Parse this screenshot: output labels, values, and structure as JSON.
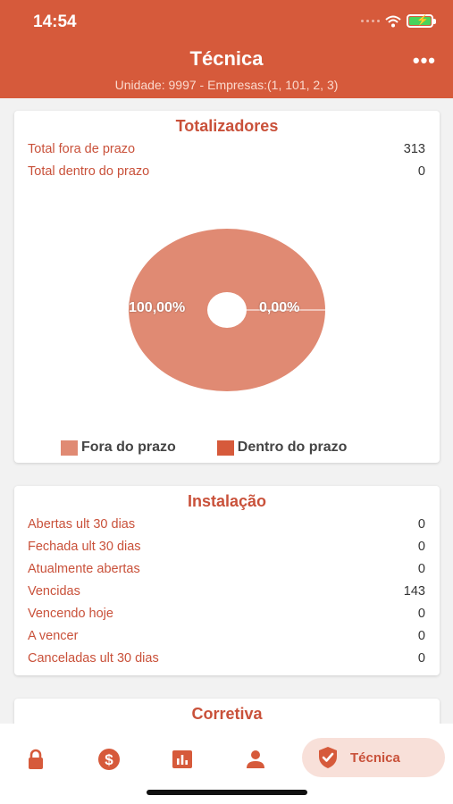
{
  "status_bar": {
    "time": "14:54",
    "battery_color": "#49d35b"
  },
  "header": {
    "title": "Técnica",
    "subtitle": "Unidade: 9997 - Empresas:(1, 101, 2, 3)",
    "more_label": "•••",
    "background": "#d65a3b"
  },
  "totalizadores": {
    "title": "Totalizadores",
    "rows": [
      {
        "label": "Total fora de prazo",
        "value": "313"
      },
      {
        "label": "Total dentro do prazo",
        "value": "0"
      }
    ]
  },
  "chart_data": {
    "type": "pie",
    "categories": [
      "Fora do prazo",
      "Dentro do prazo"
    ],
    "values": [
      313,
      0
    ],
    "percent_labels": [
      "100,00%",
      "0,00%"
    ],
    "colors": [
      "#e08a73",
      "#d65a3b"
    ],
    "legend_position": "bottom"
  },
  "instalacao": {
    "title": "Instalação",
    "rows": [
      {
        "label": "Abertas ult 30 dias",
        "value": "0"
      },
      {
        "label": "Fechada ult 30 dias",
        "value": "0"
      },
      {
        "label": "Atualmente abertas",
        "value": "0"
      },
      {
        "label": "Vencidas",
        "value": "143"
      },
      {
        "label": "Vencendo hoje",
        "value": "0"
      },
      {
        "label": "A vencer",
        "value": "0"
      },
      {
        "label": "Canceladas ult 30 dias",
        "value": "0"
      }
    ]
  },
  "corretiva": {
    "title": "Corretiva"
  },
  "tabbar": {
    "tabs": [
      {
        "icon": "lock-icon"
      },
      {
        "icon": "dollar-icon"
      },
      {
        "icon": "bar-chart-icon"
      },
      {
        "icon": "person-icon"
      },
      {
        "icon": "shield-check-icon",
        "label": "Técnica",
        "active": true
      }
    ],
    "accent": "#d65a3b"
  }
}
